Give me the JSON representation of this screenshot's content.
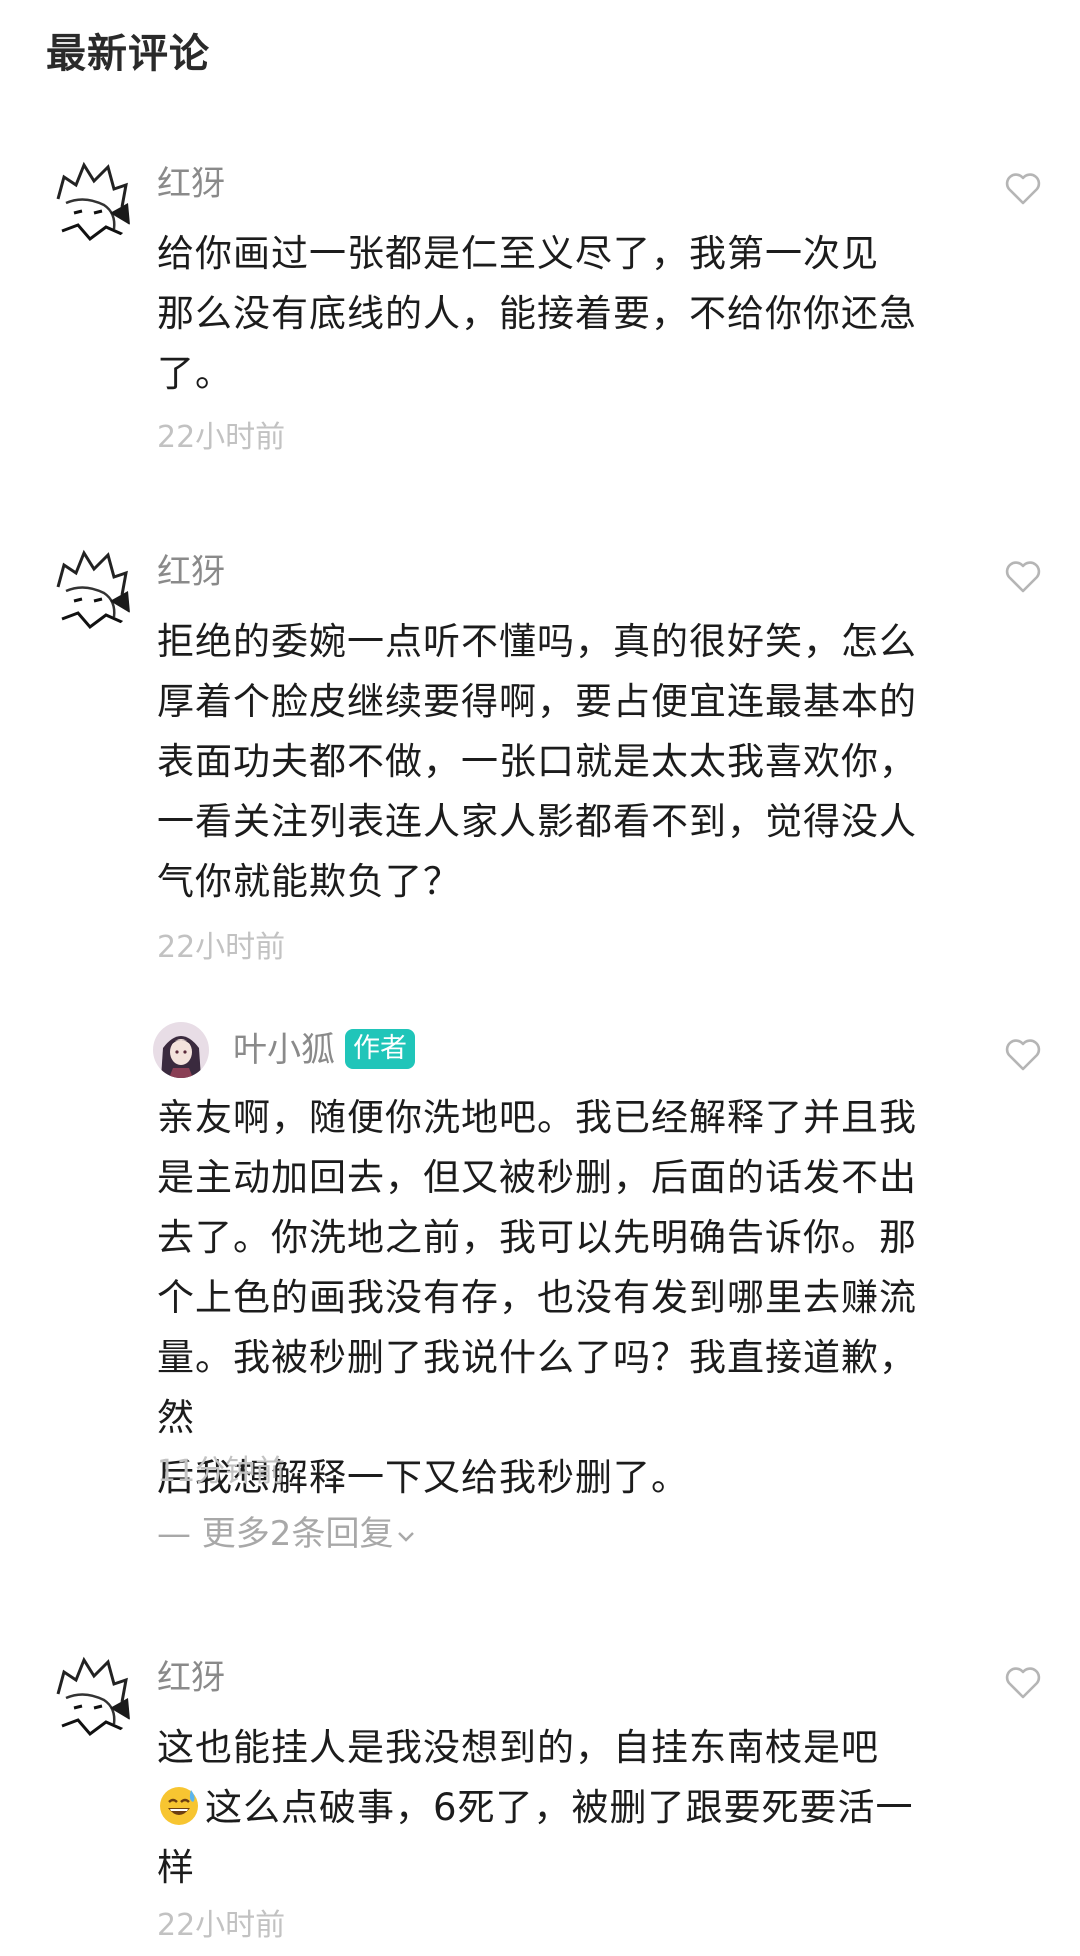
{
  "header": {
    "title": "最新评论"
  },
  "colors": {
    "author_badge": "#20c5b9",
    "meta_text": "#c2c2c2"
  },
  "comments": [
    {
      "username": "红犽",
      "text": [
        "给你画过一张都是仁至义尽了，我第一次见",
        "那么没有底线的人，能接着要，不给你你还急",
        "了。"
      ],
      "time": "22小时前"
    },
    {
      "username": "红犽",
      "text": [
        "拒绝的委婉一点听不懂吗，真的很好笑，怎么",
        "厚着个脸皮继续要得啊，要占便宜连最基本的",
        "表面功夫都不做，一张口就是太太我喜欢你，",
        "一看关注列表连人家人影都看不到，觉得没人",
        "气你就能欺负了？"
      ],
      "time": "22小时前"
    },
    {
      "username": "红犽",
      "text": [
        "这也能挂人是我没想到的，自挂东南枝是吧",
        "这么点破事，6死了，被删了跟要死要活一",
        "样"
      ],
      "emoji_icon": "sweat-smile-emoji",
      "time": "22小时前"
    }
  ],
  "reply": {
    "username": "叶小狐",
    "badge": "作者",
    "text": [
      "亲友啊，随便你洗地吧。我已经解释了并且我",
      "是主动加回去，但又被秒删，后面的话发不出",
      "去了。你洗地之前，我可以先明确告诉你。那",
      "个上色的画我没有存，也没有发到哪里去赚流",
      "量。我被秒删了我说什么了吗？我直接道歉，然",
      "后我想解释一下又给我秒删了。"
    ],
    "time": "11分钟前",
    "more_replies": "— 更多2条回复"
  },
  "icons": {
    "like": "heart-outline-icon",
    "expand": "chevron-down-icon"
  }
}
